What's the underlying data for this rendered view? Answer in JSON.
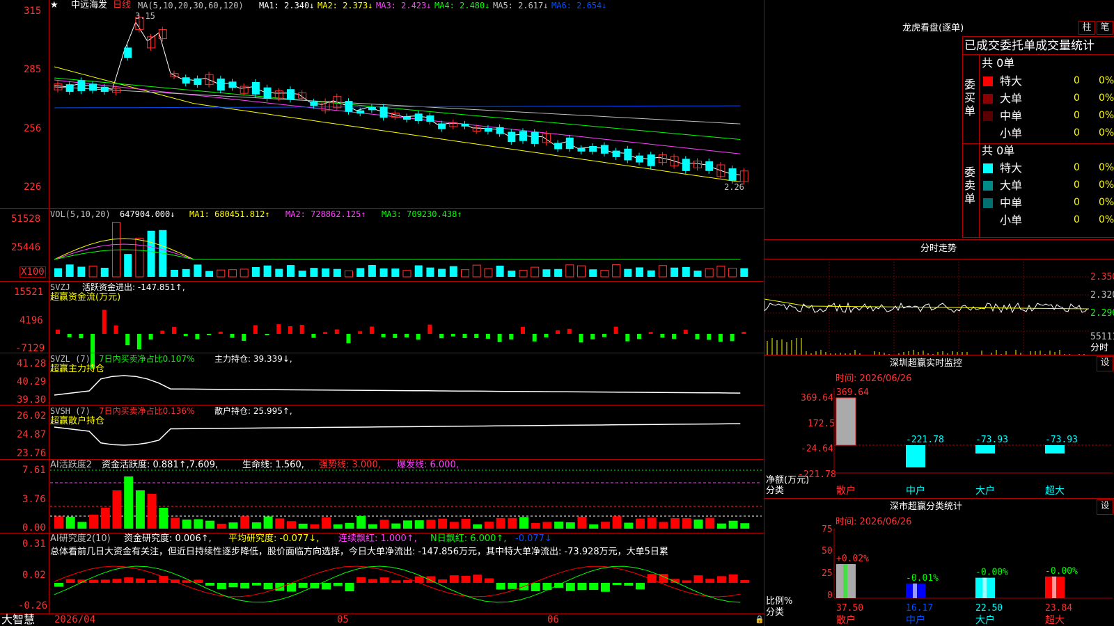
{
  "stock": {
    "name": "中远海发",
    "period": "日线",
    "star": "★"
  },
  "main_panel": {
    "ma_line": [
      "MA(5,10,20,30,60,120)",
      "MA1: 2.340↓",
      "MA2: 2.373↓",
      "MA3: 2.423↓",
      "MA4: 2.480↓",
      "MA5: 2.617↓",
      "MA6: 2.654↓"
    ],
    "y_ticks": [
      "315",
      "285",
      "256",
      "226"
    ],
    "high_mark": "3.15",
    "low_mark": "2.26"
  },
  "vol_panel": {
    "title": "VOL(5,10,20)",
    "vol": "647904.000↓",
    "ma1": "MA1: 680451.812↑",
    "ma2": "MA2: 728862.125↑",
    "ma3": "MA3: 709230.438↑",
    "y_ticks": [
      "51528",
      "25446"
    ],
    "unit": "X100"
  },
  "svzj_panel": {
    "title": "SVZJ",
    "label": "活跃资金进出: -147.851↑,",
    "sub": "超赢资金流(万元)",
    "y_ticks": [
      "15521",
      "4196",
      "-7129"
    ]
  },
  "svzl_panel": {
    "title": "SVZL (7)",
    "ratio": "7日内买卖净占比0.107%",
    "hold": "主力持仓: 39.339↓,",
    "sub": "超赢主力持仓",
    "y_ticks": [
      "41.28",
      "40.29",
      "39.30"
    ]
  },
  "svsh_panel": {
    "title": "SVSH (7)",
    "ratio": "7日内买卖净占比0.136%",
    "hold": "散户持仓: 25.995↑,",
    "sub": "超赢散户持仓",
    "y_ticks": [
      "26.02",
      "24.87",
      "23.76"
    ]
  },
  "ai_active_panel": {
    "title": "AI活跃度2",
    "active": "资金活跃度: 0.881↑,7.609,",
    "life": "生命线: 1.560,",
    "strong": "强势线: 3.000,",
    "burst": "爆发线: 6.000,",
    "y_ticks": [
      "7.61",
      "3.76",
      "0.00"
    ]
  },
  "ai_research_panel": {
    "title": "AI研究度2(10)",
    "research": "资金研究度: 0.006↑,",
    "avg": "平均研究度: -0.077↓,",
    "cont": "连续飘红: 1.000↑,",
    "nday": "N日飘红: 6.000↑,",
    "last": "-0.077↓",
    "summary": "总体看前几日大资金有关注，但近日持续性逐步降低，股价面临方向选择，今日大单净流出: -147.856万元，其中特大单净流出: -73.928万元，大单5日累",
    "y_ticks": [
      "0.31",
      "0.02",
      "-0.26"
    ]
  },
  "x_axis": {
    "brand": "大智慧",
    "dates": [
      "2026/04",
      "05",
      "06"
    ]
  },
  "dragon_tiger": {
    "title": "龙虎看盘(逐单)",
    "tab_bar": "柱",
    "tab_pen": "笔",
    "header": "已成交委托单成交量统计",
    "buy": {
      "side": "委买单",
      "total": "共 0单",
      "rows": [
        {
          "label": "特大",
          "count": "0",
          "pct": "0%",
          "color": "#ff0000"
        },
        {
          "label": "大单",
          "count": "0",
          "pct": "0%",
          "color": "#8b0000"
        },
        {
          "label": "中单",
          "count": "0",
          "pct": "0%",
          "color": "#5a0000"
        },
        {
          "label": "小单",
          "count": "0",
          "pct": "0%",
          "color": ""
        }
      ]
    },
    "sell": {
      "side": "委卖单",
      "total": "共 0单",
      "rows": [
        {
          "label": "特大",
          "count": "0",
          "pct": "0%",
          "color": "#00ffff"
        },
        {
          "label": "大单",
          "count": "0",
          "pct": "0%",
          "color": "#008b8b"
        },
        {
          "label": "中单",
          "count": "0",
          "pct": "0%",
          "color": "#007070"
        },
        {
          "label": "小单",
          "count": "0",
          "pct": "0%",
          "color": ""
        }
      ]
    }
  },
  "intraday": {
    "title": "分时走势",
    "y_ticks": [
      "2.350",
      "2.320",
      "2.290"
    ],
    "vol_tick": "55111",
    "label": "分时"
  },
  "realtime_monitor": {
    "title": "深圳超赢实时监控",
    "settings": "设",
    "time": "时间: 2026/06/26",
    "y_ticks": [
      "369.64",
      "172.5",
      "-24.64",
      "-221.78"
    ],
    "axis_label": "净额(万元)",
    "axis_label2": "分类",
    "bars": [
      {
        "cat": "散户",
        "value": "369.64"
      },
      {
        "cat": "中户",
        "value": "-221.78"
      },
      {
        "cat": "大户",
        "value": "-73.93"
      },
      {
        "cat": "超大",
        "value": "-73.93"
      }
    ]
  },
  "classify_stats": {
    "title": "深市超赢分类统计",
    "settings": "设",
    "time": "时间: 2026/06/26",
    "y_ticks": [
      "75",
      "50",
      "25",
      "0"
    ],
    "axis_label": "比例%",
    "axis_label2": "分类",
    "bars": [
      {
        "cat": "散户",
        "change": "+0.02%",
        "value": "37.50"
      },
      {
        "cat": "中户",
        "change": "-0.01%",
        "value": "16.17"
      },
      {
        "cat": "大户",
        "change": "-0.00%",
        "value": "22.50"
      },
      {
        "cat": "超大",
        "change": "-0.00%",
        "value": "23.84"
      }
    ]
  }
}
